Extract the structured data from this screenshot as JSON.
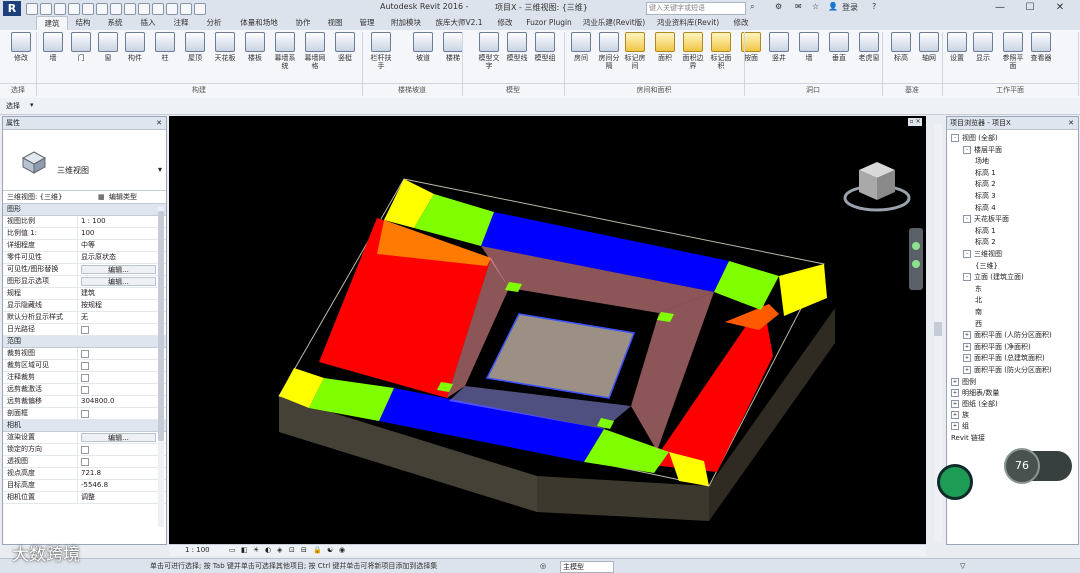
{
  "window": {
    "title": "Autodesk Revit 2016 -",
    "doc_title": "项目X - 三维视图: {三维}",
    "search_placeholder": "键入关键字或短语",
    "user": "登录"
  },
  "tabs": [
    "建筑",
    "结构",
    "系统",
    "插入",
    "注释",
    "分析",
    "体量和场地",
    "协作",
    "视图",
    "管理",
    "附加模块",
    "族库大师V2.1",
    "修改",
    "Fuzor Plugin",
    "鸿业乐建(Revit版)",
    "鸿业资料库(Revit)",
    "修改"
  ],
  "ribbon": {
    "buttons": [
      "修改",
      "墙",
      "门",
      "窗",
      "构件",
      "柱",
      "屋顶",
      "天花板",
      "楼板",
      "幕墙系统",
      "幕墙网格",
      "竖梃",
      "栏杆扶手",
      "坡道",
      "楼梯",
      "模型文字",
      "模型线",
      "模型组",
      "房间",
      "房间分隔",
      "标记房间",
      "面积",
      "面积边界",
      "标记面积",
      "按面",
      "竖井",
      "墙",
      "垂直",
      "老虎窗",
      "标高",
      "轴网",
      "设置",
      "显示",
      "参照平面",
      "查看器"
    ],
    "groups": [
      "选择",
      "构建",
      "楼梯坡道",
      "模型",
      "房间和面积",
      "洞口",
      "基准",
      "工作平面"
    ]
  },
  "options": {
    "select": "选择"
  },
  "properties": {
    "title": "属性",
    "type_name": "三维视图",
    "type_selector": "三维视图: {三维}",
    "edit_type": "编辑类型",
    "sections": [
      {
        "name": "图形",
        "rows": [
          [
            "视图比例",
            "1 : 100"
          ],
          [
            "比例值 1:",
            "100"
          ],
          [
            "详细程度",
            "中等"
          ],
          [
            "零件可见性",
            "显示原状态"
          ],
          [
            "可见性/图形替换",
            "编辑..."
          ],
          [
            "图形显示选项",
            "编辑..."
          ],
          [
            "规程",
            "建筑"
          ],
          [
            "显示隐藏线",
            "按规程"
          ],
          [
            "默认分析显示样式",
            "无"
          ],
          [
            "日光路径",
            ""
          ]
        ]
      },
      {
        "name": "范围",
        "rows": [
          [
            "裁剪视图",
            ""
          ],
          [
            "裁剪区域可见",
            ""
          ],
          [
            "注释裁剪",
            ""
          ],
          [
            "远剪裁激活",
            ""
          ],
          [
            "远剪裁偏移",
            "304800.0"
          ],
          [
            "剖面框",
            ""
          ]
        ]
      },
      {
        "name": "相机",
        "rows": [
          [
            "渲染设置",
            "编辑..."
          ],
          [
            "锁定的方向",
            ""
          ],
          [
            "透视图",
            ""
          ],
          [
            "视点高度",
            "721.8"
          ],
          [
            "目标高度",
            "-5546.8"
          ],
          [
            "相机位置",
            "调整"
          ]
        ]
      }
    ]
  },
  "browser": {
    "title": "项目浏览器 - 项目X",
    "items": [
      {
        "label": "视图 (全部)",
        "level": 0,
        "toggle": "-"
      },
      {
        "label": "楼层平面",
        "level": 1,
        "toggle": "-"
      },
      {
        "label": "场地",
        "level": 2
      },
      {
        "label": "标高 1",
        "level": 2
      },
      {
        "label": "标高 2",
        "level": 2
      },
      {
        "label": "标高 3",
        "level": 2
      },
      {
        "label": "标高 4",
        "level": 2
      },
      {
        "label": "天花板平面",
        "level": 1,
        "toggle": "-"
      },
      {
        "label": "标高 1",
        "level": 2
      },
      {
        "label": "标高 2",
        "level": 2
      },
      {
        "label": "三维视图",
        "level": 1,
        "toggle": "-"
      },
      {
        "label": "{三维}",
        "level": 2
      },
      {
        "label": "立面 (建筑立面)",
        "level": 1,
        "toggle": "-"
      },
      {
        "label": "东",
        "level": 2
      },
      {
        "label": "北",
        "level": 2
      },
      {
        "label": "南",
        "level": 2
      },
      {
        "label": "西",
        "level": 2
      },
      {
        "label": "面积平面 (人防分区面积)",
        "level": 1,
        "toggle": "+"
      },
      {
        "label": "面积平面 (净面积)",
        "level": 1,
        "toggle": "+"
      },
      {
        "label": "面积平面 (总建筑面积)",
        "level": 1,
        "toggle": "+"
      },
      {
        "label": "面积平面 (防火分区面积)",
        "level": 1,
        "toggle": "+"
      },
      {
        "label": "图例",
        "level": 0,
        "toggle": "+"
      },
      {
        "label": "明细表/数量",
        "level": 0,
        "toggle": "+"
      },
      {
        "label": "图纸 (全部)",
        "level": 0,
        "toggle": "+"
      },
      {
        "label": "族",
        "level": 0,
        "toggle": "+"
      },
      {
        "label": "组",
        "level": 0,
        "toggle": "+"
      },
      {
        "label": "Revit 链接",
        "level": 0
      }
    ]
  },
  "viewbar": {
    "scale": "1 : 100"
  },
  "status": {
    "text": "单击可进行选择; 按 Tab 键并单击可选择其他项目; 按 Ctrl 键并单击可将新项目添加到选择集",
    "model": "主模型",
    "zoom_left": "▼ 2 · 1 · 1"
  },
  "widgets": {
    "speed": "76"
  },
  "watermark": "大数跨境",
  "colors": {
    "yellow": "#ffff00",
    "green": "#7fff00",
    "blue": "#0000ff",
    "red": "#ff0000",
    "orange": "#ff8000",
    "pit": "#9c8f84",
    "accent": "#1d3f7a"
  }
}
